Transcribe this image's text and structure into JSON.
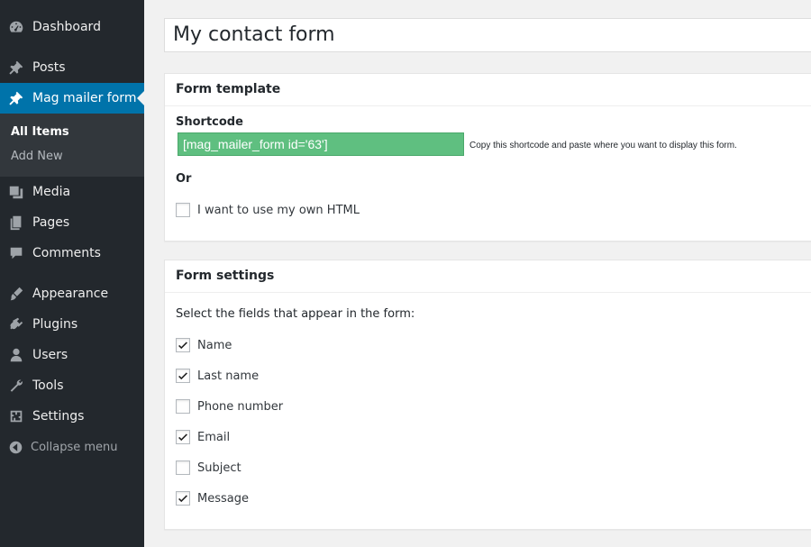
{
  "sidebar": {
    "items": [
      {
        "label": "Dashboard",
        "icon": "dashboard-icon"
      },
      {
        "label": "Posts",
        "icon": "pin-icon"
      },
      {
        "label": "Mag mailer form",
        "icon": "pin-icon"
      },
      {
        "label": "Media",
        "icon": "media-icon"
      },
      {
        "label": "Pages",
        "icon": "pages-icon"
      },
      {
        "label": "Comments",
        "icon": "comment-icon"
      },
      {
        "label": "Appearance",
        "icon": "brush-icon"
      },
      {
        "label": "Plugins",
        "icon": "plugin-icon"
      },
      {
        "label": "Users",
        "icon": "user-icon"
      },
      {
        "label": "Tools",
        "icon": "wrench-icon"
      },
      {
        "label": "Settings",
        "icon": "settings-icon"
      }
    ],
    "submenu": [
      "All Items",
      "Add New"
    ],
    "collapse_label": "Collapse menu"
  },
  "post": {
    "title": "My contact form"
  },
  "form_template": {
    "heading": "Form template",
    "shortcode_label": "Shortcode",
    "shortcode": "[mag_mailer_form id='63']",
    "hint": "Copy this shortcode and paste where you want to display this form.",
    "or_label": "Or",
    "own_html_label": "I want to use my own HTML",
    "own_html_checked": false
  },
  "form_settings": {
    "heading": "Form settings",
    "description": "Select the fields that appear in the form:",
    "fields": [
      {
        "label": "Name",
        "checked": true
      },
      {
        "label": "Last name",
        "checked": true
      },
      {
        "label": "Phone number",
        "checked": false
      },
      {
        "label": "Email",
        "checked": true
      },
      {
        "label": "Subject",
        "checked": false
      },
      {
        "label": "Message",
        "checked": true
      }
    ]
  },
  "colors": {
    "sidebar_bg": "#23282d",
    "active_bg": "#0073aa",
    "shortcode_bg": "#5fbf80"
  }
}
